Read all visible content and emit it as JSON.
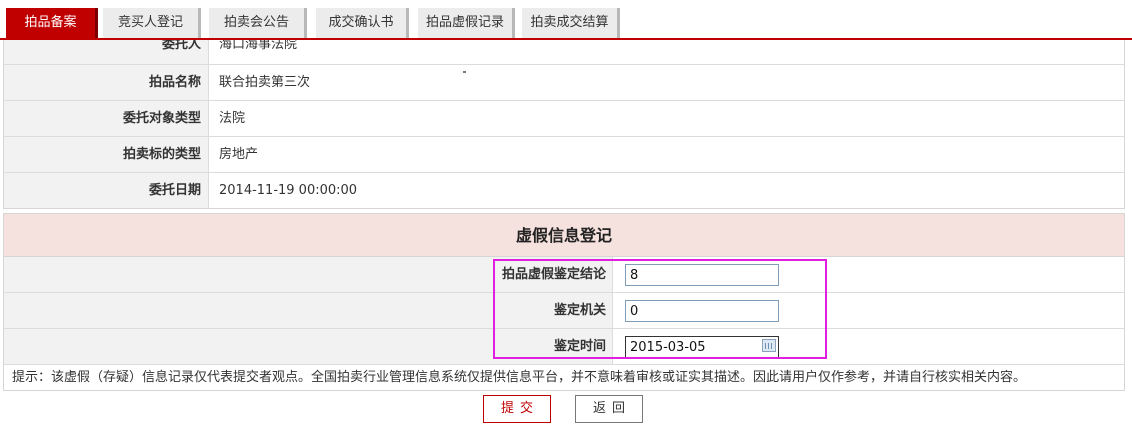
{
  "tabs": [
    {
      "label": "拍品备案",
      "active": true
    },
    {
      "label": "竞买人登记",
      "active": false
    },
    {
      "label": "拍卖会公告",
      "active": false
    },
    {
      "label": "成交确认书",
      "active": false
    },
    {
      "label": "拍品虚假记录",
      "active": false
    },
    {
      "label": "拍卖成交结算",
      "active": false
    }
  ],
  "info": {
    "rows": [
      {
        "label": "委托人",
        "value": "海口海事法院"
      },
      {
        "label": "拍品名称",
        "value": "联合拍卖第三次"
      },
      {
        "label": "委托对象类型",
        "value": "法院"
      },
      {
        "label": "拍卖标的类型",
        "value": "房地产"
      },
      {
        "label": "委托日期",
        "value": "2014-11-19 00:00:00"
      }
    ]
  },
  "false_info_form": {
    "title": "虚假信息登记",
    "fields": [
      {
        "label": "拍品虚假鉴定结论",
        "value": "8"
      },
      {
        "label": "鉴定机关",
        "value": "0"
      },
      {
        "label": "鉴定时间",
        "value": "2015-03-05"
      }
    ],
    "tip": "提示：该虚假（存疑）信息记录仅代表提交者观点。全国拍卖行业管理信息系统仅提供信息平台，并不意味着审核或证实其描述。因此请用户仅作参考，并请自行核实相关内容。"
  },
  "buttons": {
    "submit": "提交",
    "back": "返回"
  },
  "colors": {
    "accent": "#c00000",
    "highlight": "#e020e0",
    "header_bg": "#f5e1de"
  }
}
